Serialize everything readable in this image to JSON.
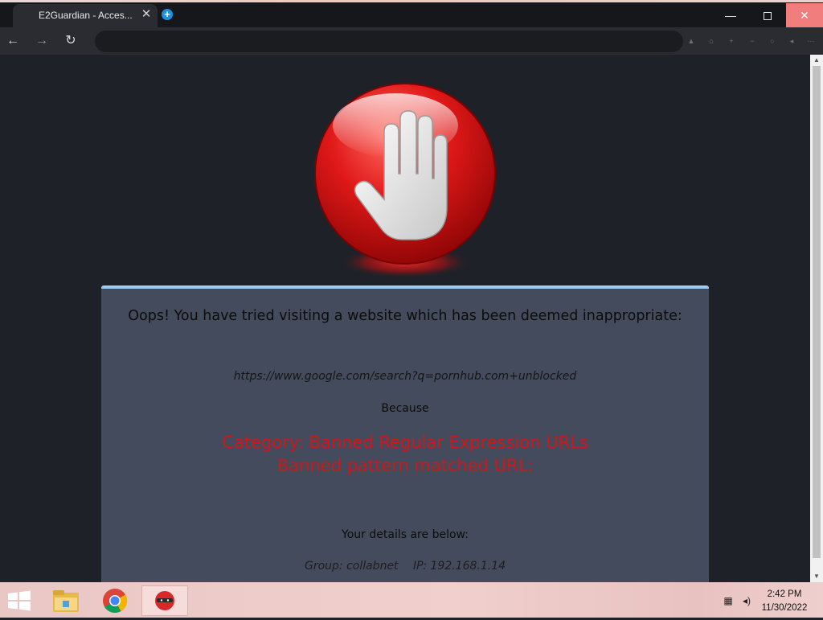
{
  "browser": {
    "tab_title": "E2Guardian - Acces...",
    "tab_close_glyph": "✕",
    "new_tab_glyph": "+",
    "window_controls": {
      "minimize_glyph": "—",
      "close_glyph": "✕"
    },
    "nav": {
      "back_glyph": "←",
      "forward_glyph": "→",
      "reload_glyph": "↻"
    },
    "address": "",
    "extension_icons": [
      "extension-icon",
      "home-icon",
      "add-icon",
      "remove-icon",
      "circle-icon",
      "speaker-icon",
      "more-icon"
    ]
  },
  "page": {
    "headline": "Oops! You have tried visiting a website which has been deemed inappropriate:",
    "blocked_url": "https://www.google.com/search?q=pornhub.com+unblocked",
    "because": "Because",
    "reason_line1": "Category: Banned Regular Expression URLs",
    "reason_line2": "Banned pattern matched URL:",
    "details_title": "Your details are below:",
    "group": "Group: collabnet",
    "ip": "IP: 192.168.1.14"
  },
  "taskbar": {
    "items": [
      "windows-start",
      "file-explorer",
      "google-chrome",
      "e2guardian-app"
    ],
    "clock_time": "2:42 PM",
    "clock_date": "11/30/2022"
  },
  "colors": {
    "page_background": "#1f2128",
    "panel_background": "#434b5c",
    "panel_border": "#9ecbf1",
    "reason_text": "#d0161a",
    "stop_red": "#e01818"
  }
}
